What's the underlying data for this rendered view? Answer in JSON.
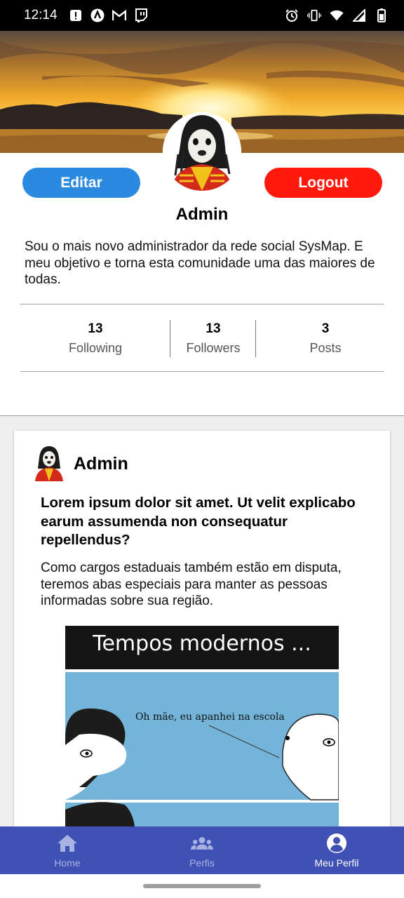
{
  "status_bar": {
    "time": "12:14",
    "left_icons": [
      "alert-icon",
      "app-a-icon",
      "gmail-icon",
      "twitch-icon"
    ],
    "right_icons": [
      "alarm-icon",
      "vibrate-icon",
      "wifi-icon",
      "signal-icon",
      "battery-icon"
    ]
  },
  "profile": {
    "edit_label": "Editar",
    "logout_label": "Logout",
    "name": "Admin",
    "bio": "Sou o mais novo administrador da rede social SysMap. E meu objetivo e torna esta comunidade uma das maiores de todas.",
    "stats": [
      {
        "value": "13",
        "label": "Following"
      },
      {
        "value": "13",
        "label": "Followers"
      },
      {
        "value": "3",
        "label": "Posts"
      }
    ]
  },
  "post": {
    "author": "Admin",
    "title": "Lorem ipsum dolor sit amet. Ut velit explicabo earum assumenda non consequatur repellendus?",
    "body": "Como cargos estaduais também estão em disputa, teremos abas especiais para manter as pessoas informadas sobre sua região.",
    "image": {
      "heading": "Tempos modernos ...",
      "speech": "Oh mãe, eu apanhei na escola"
    }
  },
  "nav": {
    "items": [
      {
        "label": "Home",
        "icon": "home-icon"
      },
      {
        "label": "Perfis",
        "icon": "people-icon"
      },
      {
        "label": "Meu Perfil",
        "icon": "account-circle-icon"
      }
    ],
    "active": "Meu Perfil"
  },
  "colors": {
    "edit_button": "#2a8adf",
    "logout_button": "#ff1a0d",
    "nav_bar": "#3f51b5"
  }
}
